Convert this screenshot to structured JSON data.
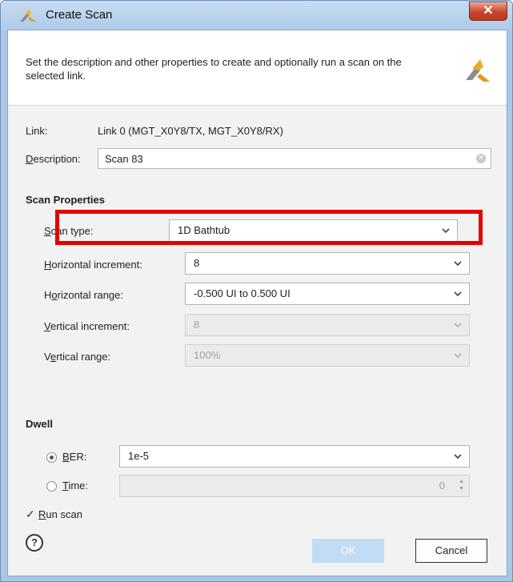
{
  "window": {
    "title": "Create Scan",
    "close_label": "✕"
  },
  "header": {
    "description": "Set the description and other properties to create and optionally run a scan on the selected link."
  },
  "link": {
    "label": "Link:",
    "value": "Link 0 (MGT_X0Y8/TX, MGT_X0Y8/RX)"
  },
  "description": {
    "label_mnemonic": "D",
    "label_rest": "escription:",
    "value": "Scan 83"
  },
  "scan_properties": {
    "title": "Scan Properties",
    "scan_type": {
      "label_mnemonic": "S",
      "label_rest": "can type:",
      "value": "1D Bathtub"
    },
    "horizontal_increment": {
      "label_mnemonic": "H",
      "label_rest": "orizontal increment:",
      "value": "8"
    },
    "horizontal_range": {
      "label_pre": "H",
      "label_mnemonic": "o",
      "label_rest": "rizontal range:",
      "value": "-0.500 UI to 0.500 UI"
    },
    "vertical_increment": {
      "label_mnemonic": "V",
      "label_rest": "ertical increment:",
      "value": "8"
    },
    "vertical_range": {
      "label_pre": "V",
      "label_mnemonic": "e",
      "label_rest": "rtical range:",
      "value": "100%"
    }
  },
  "dwell": {
    "title": "Dwell",
    "ber": {
      "label_mnemonic": "B",
      "label_rest": "ER:",
      "value": "1e-5",
      "selected": true
    },
    "time": {
      "label_mnemonic": "T",
      "label_rest": "ime:",
      "value": "0",
      "selected": false
    }
  },
  "run_scan": {
    "label_mnemonic": "R",
    "label_rest": "un scan",
    "checked": true
  },
  "buttons": {
    "help": "?",
    "ok": "OK",
    "cancel": "Cancel"
  },
  "colors": {
    "highlight": "#e30000",
    "title_bar": "#aecbe9",
    "close_button": "#c8452c"
  }
}
